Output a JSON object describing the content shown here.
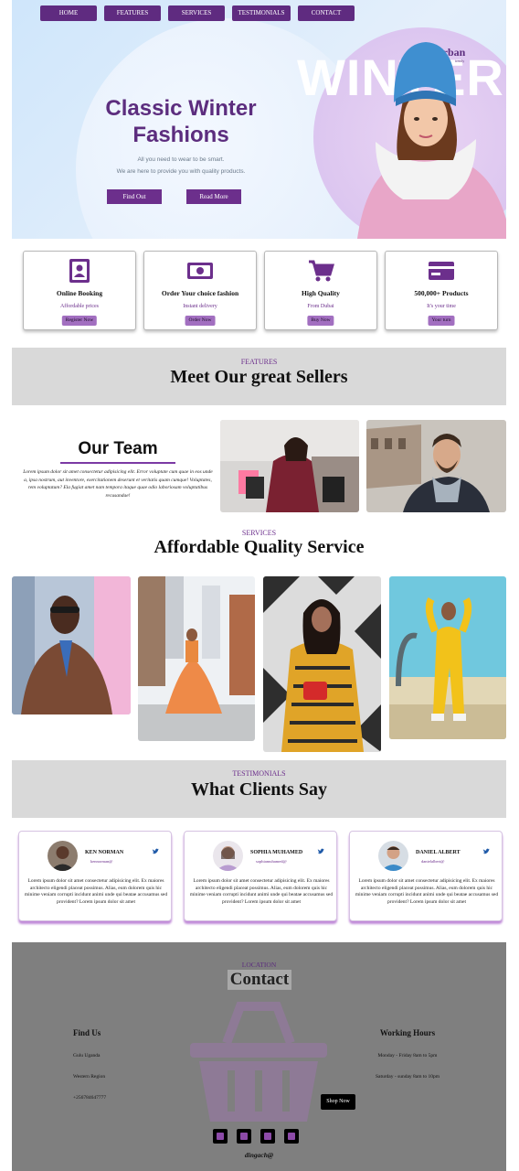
{
  "nav": {
    "items": [
      "HOME",
      "FEATURES",
      "SERVICES",
      "TESTIMONIALS",
      "CONTACT"
    ]
  },
  "hero": {
    "title_line1": "Classic Winter",
    "title_line2": "Fashions",
    "sub_line1": "All you need to wear to be smart.",
    "sub_line2": "We are here to provide you with quality products.",
    "find_out_label": "Find Out",
    "read_more_label": "Read More",
    "banner_big": "WINTER",
    "banner_urban": "Urban",
    "banner_small": "trendy"
  },
  "features_cards": [
    {
      "icon": "booking-icon",
      "title": "Online Booking",
      "sub": "Affordable prices",
      "button": "Register Now"
    },
    {
      "icon": "money-icon",
      "title": "Order Your choice fashion",
      "sub": "Instant delivery",
      "button": "Order Now"
    },
    {
      "icon": "cart-icon",
      "title": "High Quality",
      "sub": "From Dubai",
      "button": "Buy Now"
    },
    {
      "icon": "credit-card-icon",
      "title": "500,000+ Products",
      "sub": "It's your time",
      "button": "Your turn"
    }
  ],
  "features_section": {
    "kicker": "FEATURES",
    "heading": "Meet Our great Sellers"
  },
  "team": {
    "title": "Our Team",
    "text": "Lorem ipsum dolor sit amet consectetur adipisicing elit. Error voluptate cum quae in eos unde a, ipsa nostrum, aut inventore, exercitationem deserunt et veritatis quam cumque! Voluptates, rem voluptatum? Ela fugiat amet nam tempora itaque quae odio laboriosam voluptatibus recusandae!"
  },
  "services_section": {
    "kicker": "SERVICES",
    "heading": "Affordable Quality Service"
  },
  "testimonials_section": {
    "kicker": "TESTIMONIALS",
    "heading": "What Clients Say"
  },
  "testimonials": [
    {
      "name": "KEN NORMAN",
      "handle": "kennorman@",
      "text": "Lorem ipsum dolor sit amet consectetur adipisicing elit. Ex maiores architecto eligendi placeat possimus. Alias, eum dolorem quis hic minime veniam corrupti incidunt animi unde qui beatae accusamus sed provident? Lorem ipsum dolor sit amet"
    },
    {
      "name": "SOPHIA MUHAMED",
      "handle": "sophiamuhamed@",
      "text": "Lorem ipsum dolor sit amet consectetur adipisicing elit. Ex maiores architecto eligendi placeat possimus. Alias, eum dolorem quis hic minime veniam corrupti incidunt animi unde qui beatae accusamus sed provident? Lorem ipsum dolor sit amet"
    },
    {
      "name": "DANIEL ALBERT",
      "handle": "danielalbert@",
      "text": "Lorem ipsum dolor sit amet consectetur adipisicing elit. Ex maiores architecto eligendi placeat possimus. Alias, eum dolorem quis hic minime veniam corrupti incidunt animi unde qui beatae accusamus sed provident? Lorem ipsum dolor sit amet"
    }
  ],
  "contact": {
    "kicker": "LOCATION",
    "heading": "Contact",
    "find_us_heading": "Find Us",
    "find_us_lines": [
      "Gulu Uganda",
      "Western Region",
      "+256784647777"
    ],
    "hours_heading": "Working Hours",
    "hours_lines": [
      "Monday - Friday 8am to 5pm",
      "Saturday - sunday 8am to 10pm"
    ],
    "shop_now_label": "Shop Now",
    "social_icons": [
      "facebook-icon",
      "twitter-icon",
      "instagram-icon",
      "linkedin-icon"
    ],
    "brand": "dingach@"
  },
  "colors": {
    "accent": "#6c2f8c",
    "hero_bg": "#d9ebfb",
    "section_bg": "#d9d9d9",
    "footer_bg": "#7f7f7f"
  }
}
